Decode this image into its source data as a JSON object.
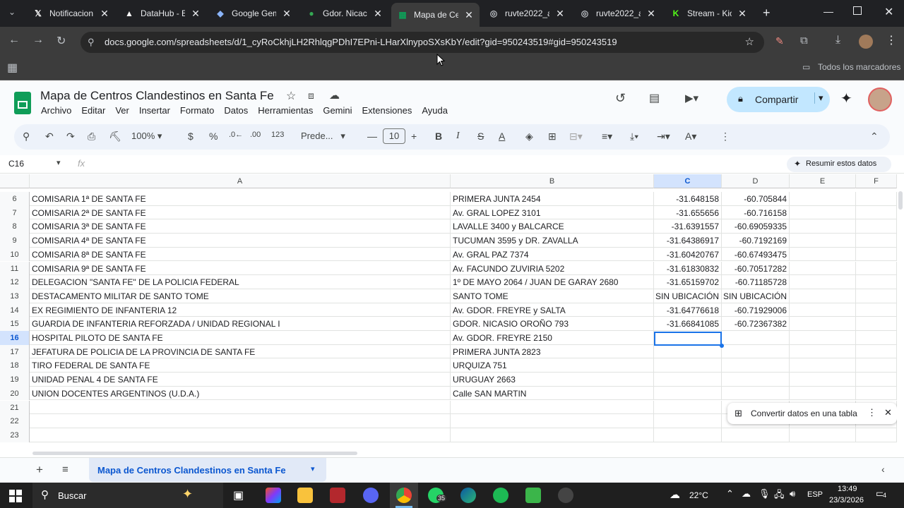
{
  "browser": {
    "tabs": [
      {
        "title": "Notificacion",
        "icon": "x-logo-icon",
        "active": false
      },
      {
        "title": "DataHub - E",
        "icon": "datahub-icon",
        "active": false
      },
      {
        "title": "Google Gem",
        "icon": "gemini-icon",
        "active": false
      },
      {
        "title": "Gdor. Nicac",
        "icon": "maps-pin-icon",
        "active": false
      },
      {
        "title": "Mapa de Ce",
        "icon": "sheets-icon",
        "active": true
      },
      {
        "title": "ruvte2022_ar",
        "icon": "globe-icon",
        "active": false
      },
      {
        "title": "ruvte2022_ar",
        "icon": "globe-icon",
        "active": false
      },
      {
        "title": "Stream - Kic",
        "icon": "kick-icon",
        "active": false
      }
    ],
    "url": "docs.google.com/spreadsheets/d/1_cyRoCkhjLH2RhlqgPDhI7EPni-LHarXlnypoSXsKbY/edit?gid=950243519#gid=950243519",
    "bookmarks_label": "Todos los marcadores"
  },
  "doc": {
    "title": "Mapa de Centros Clandestinos en Santa Fe",
    "menu": [
      "Archivo",
      "Editar",
      "Ver",
      "Insertar",
      "Formato",
      "Datos",
      "Herramientas",
      "Gemini",
      "Extensiones",
      "Ayuda"
    ],
    "share_label": "Compartir",
    "zoom": "100%",
    "font": "Prede...",
    "font_size": "10",
    "cell_ref": "C16",
    "summarize_label": "Resumir estos datos",
    "convert_label": "Convertir datos en una tabla",
    "sheet_tab": "Mapa de Centros Clandestinos en Santa Fe"
  },
  "columns": [
    "A",
    "B",
    "C",
    "D",
    "E",
    "F"
  ],
  "rows": [
    {
      "n": "6",
      "a": "COMISARIA 1ª DE SANTA FE",
      "b": "PRIMERA JUNTA 2454",
      "c": "-31.648158",
      "d": "-60.705844"
    },
    {
      "n": "7",
      "a": "COMISARIA 2ª DE SANTA FE",
      "b": "Av. GRAL LOPEZ 3101",
      "c": "-31.655656",
      "d": "-60.716158"
    },
    {
      "n": "8",
      "a": "COMISARIA 3ª DE SANTA FE",
      "b": "LAVALLE 3400 y BALCARCE",
      "c": "-31.6391557",
      "d": "-60.69059335"
    },
    {
      "n": "9",
      "a": "COMISARIA 4ª DE SANTA FE",
      "b": "TUCUMAN 3595 y DR. ZAVALLA",
      "c": "-31.64386917",
      "d": "-60.7192169"
    },
    {
      "n": "10",
      "a": "COMISARIA 8ª DE SANTA FE",
      "b": "Av. GRAL PAZ 7374",
      "c": "-31.60420767",
      "d": "-60.67493475"
    },
    {
      "n": "11",
      "a": "COMISARIA 9ª DE SANTA FE",
      "b": "Av. FACUNDO ZUVIRIA 5202",
      "c": "-31.61830832",
      "d": "-60.70517282"
    },
    {
      "n": "12",
      "a": "DELEGACION \"SANTA FE\" DE LA POLICIA FEDERAL",
      "b": "1º DE MAYO 2064 / JUAN DE GARAY 2680",
      "c": "-31.65159702",
      "d": "-60.71185728"
    },
    {
      "n": "13",
      "a": "DESTACAMENTO MILITAR DE SANTO TOME",
      "b": "SANTO TOME",
      "c": "SIN UBICACIÓN",
      "d": "SIN UBICACIÓN"
    },
    {
      "n": "14",
      "a": "EX REGIMIENTO DE INFANTERIA 12",
      "b": "Av. GDOR. FREYRE y SALTA",
      "c": "-31.64776618",
      "d": "-60.71929006"
    },
    {
      "n": "15",
      "a": "GUARDIA DE INFANTERIA REFORZADA / UNIDAD REGIONAL I",
      "b": "GDOR. NICASIO OROÑO 793",
      "c": "-31.66841085",
      "d": "-60.72367382"
    },
    {
      "n": "16",
      "a": "HOSPITAL PILOTO DE SANTA FE",
      "b": "Av. GDOR. FREYRE 2150",
      "c": "",
      "d": ""
    },
    {
      "n": "17",
      "a": "JEFATURA DE POLICIA DE LA PROVINCIA DE SANTA FE",
      "b": "PRIMERA JUNTA 2823",
      "c": "",
      "d": ""
    },
    {
      "n": "18",
      "a": "TIRO FEDERAL DE SANTA FE",
      "b": "URQUIZA 751",
      "c": "",
      "d": ""
    },
    {
      "n": "19",
      "a": "UNIDAD PENAL 4 DE SANTA FE",
      "b": "URUGUAY 2663",
      "c": "",
      "d": ""
    },
    {
      "n": "20",
      "a": "UNION DOCENTES ARGENTINOS (U.D.A.)",
      "b": "Calle SAN MARTIN",
      "c": "",
      "d": ""
    },
    {
      "n": "21",
      "a": "",
      "b": "",
      "c": "",
      "d": ""
    },
    {
      "n": "22",
      "a": "",
      "b": "",
      "c": "",
      "d": ""
    },
    {
      "n": "23",
      "a": "",
      "b": "",
      "c": "",
      "d": ""
    }
  ],
  "taskbar": {
    "search_label": "Buscar",
    "weather": "22°C",
    "lang": "ESP",
    "time": "13:49",
    "date": "23/3/2026",
    "notif_count": "4",
    "whatsapp_badge": "35"
  },
  "colors": {
    "active_cell": "#1a73e8",
    "share_bg": "#c2e7ff",
    "sheets_green": "#0f9d58"
  }
}
